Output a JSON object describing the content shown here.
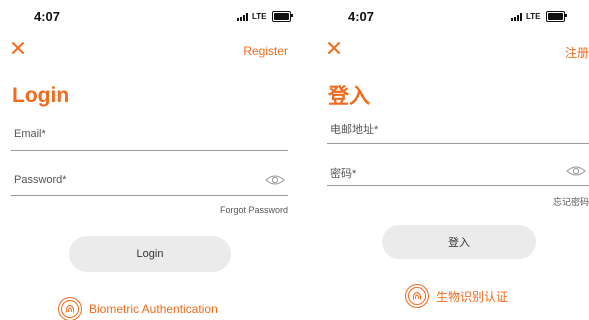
{
  "colors": {
    "accent": "#f26b1d",
    "button_bg": "#ebebeb",
    "line": "#9a9a9a"
  },
  "screens": {
    "en": {
      "status": {
        "time": "4:07",
        "network": "LTE"
      },
      "register": "Register",
      "title": "Login",
      "email_label": "Email*",
      "password_label": "Password*",
      "forgot": "Forgot Password",
      "login_button": "Login",
      "biometric": "Biometric Authentication",
      "icons": [
        "close-icon",
        "eye-icon",
        "fingerprint-icon"
      ]
    },
    "zh": {
      "status": {
        "time": "4:07",
        "network": "LTE"
      },
      "register": "注册",
      "title": "登入",
      "email_label": "电邮地址*",
      "password_label": "密码*",
      "forgot": "忘记密码",
      "login_button": "登入",
      "biometric": "生物识别认证",
      "icons": [
        "close-icon",
        "eye-icon",
        "fingerprint-icon"
      ]
    }
  }
}
